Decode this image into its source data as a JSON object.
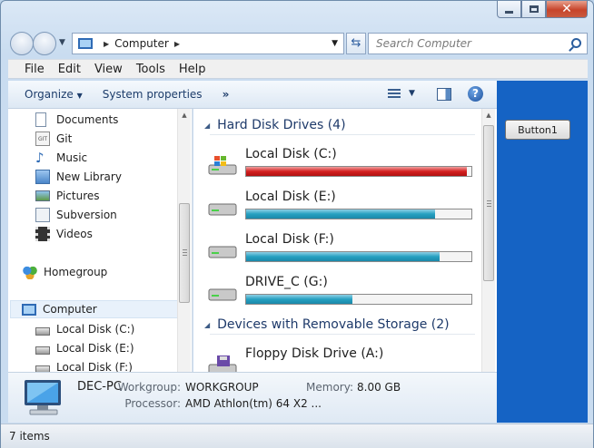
{
  "window": {
    "caption_buttons": [
      "minimize-icon",
      "maximize-icon",
      "close-icon"
    ]
  },
  "address_bar": {
    "segments": [
      "Computer"
    ],
    "refresh_icon": "refresh-icon"
  },
  "search": {
    "placeholder": "Search Computer",
    "value": ""
  },
  "menu": [
    "File",
    "Edit",
    "View",
    "Tools",
    "Help"
  ],
  "toolbar": {
    "organize": "Organize",
    "system_properties": "System properties",
    "more": "»"
  },
  "nav_pane": {
    "libraries": [
      {
        "label": "Documents",
        "icon": "documents-icon"
      },
      {
        "label": "Git",
        "icon": "git-icon"
      },
      {
        "label": "Music",
        "icon": "music-icon"
      },
      {
        "label": "New Library",
        "icon": "library-icon"
      },
      {
        "label": "Pictures",
        "icon": "pictures-icon"
      },
      {
        "label": "Subversion",
        "icon": "subversion-icon"
      },
      {
        "label": "Videos",
        "icon": "videos-icon"
      }
    ],
    "homegroup": "Homegroup",
    "computer": "Computer",
    "computer_children": [
      "Local Disk (C:)",
      "Local Disk (E:)",
      "Local Disk (F:)"
    ]
  },
  "content": {
    "hard_disk_header": "Hard Disk Drives (4)",
    "drives": [
      {
        "name": "Local Disk (C:)",
        "used_fraction": 0.98,
        "status_color": "#d42020"
      },
      {
        "name": "Local Disk (E:)",
        "used_fraction": 0.84,
        "status_color": "#26a0c0"
      },
      {
        "name": "Local Disk (F:)",
        "used_fraction": 0.86,
        "status_color": "#26a0c0"
      },
      {
        "name": "DRIVE_C (G:)",
        "used_fraction": 0.47,
        "status_color": "#26a0c0"
      }
    ],
    "removable_header": "Devices with Removable Storage (2)",
    "removable": [
      {
        "name": "Floppy Disk Drive (A:)"
      }
    ]
  },
  "details": {
    "name": "DEC-PC",
    "workgroup_label": "Workgroup:",
    "workgroup_value": "WORKGROUP",
    "memory_label": "Memory:",
    "memory_value": "8.00 GB",
    "processor_label": "Processor:",
    "processor_value": "AMD Athlon(tm) 64 X2 ..."
  },
  "status": {
    "items": "7 items"
  },
  "side_panel": {
    "button_label": "Button1",
    "color": "#1563c4"
  }
}
